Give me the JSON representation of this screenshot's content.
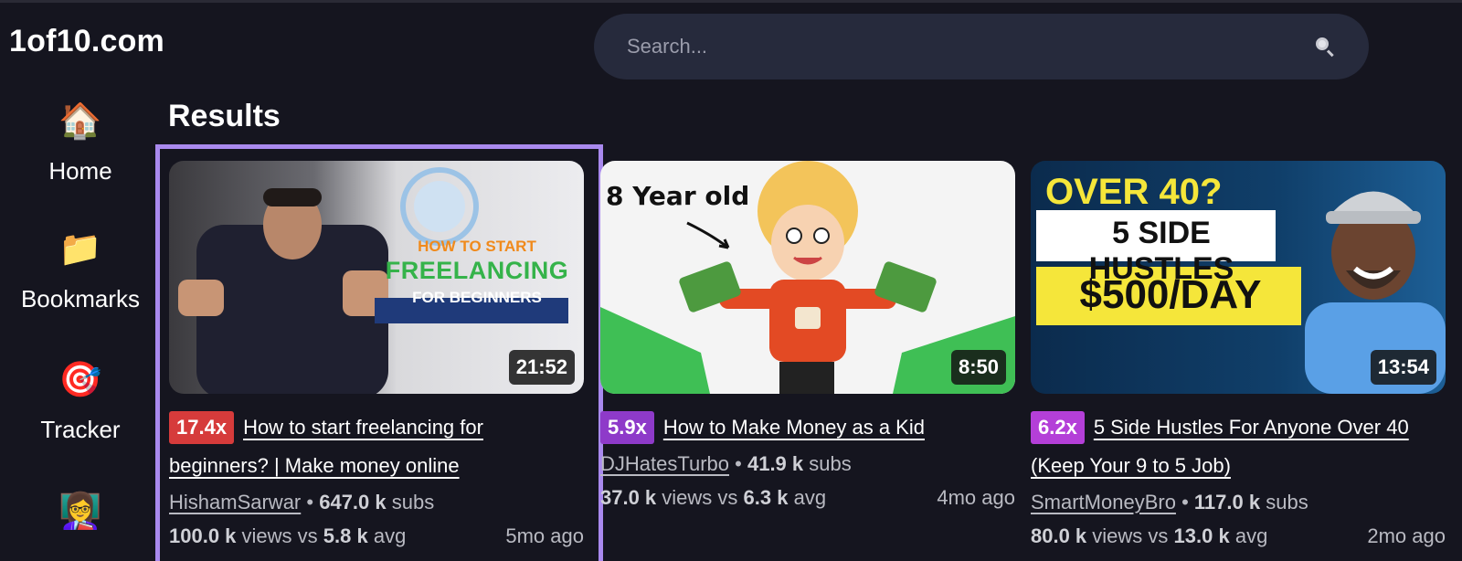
{
  "app": {
    "logo": "1of10.com"
  },
  "search": {
    "placeholder": "Search..."
  },
  "sidebar": {
    "items": [
      {
        "label": "Home",
        "icon": "house-icon",
        "glyph": "🏠"
      },
      {
        "label": "Bookmarks",
        "icon": "folder-icon",
        "glyph": "📁"
      },
      {
        "label": "Tracker",
        "icon": "target-icon",
        "glyph": "🎯"
      },
      {
        "label": "",
        "icon": "person-icon",
        "glyph": "👩‍🏫"
      }
    ]
  },
  "main": {
    "title": "Results",
    "cards": [
      {
        "duration": "21:52",
        "multiplier": "17.4x",
        "multiplier_color": "#d63b3b",
        "title": "How to start freelancing for beginners? | Make money online",
        "channel": "HishamSarwar",
        "subs_value": "647.0 k",
        "subs_label": "subs",
        "views_value": "100.0 k",
        "views_label": "views vs",
        "avg_value": "5.8 k",
        "avg_label": "avg",
        "age": "5mo ago",
        "thumb_text": [
          "HOW TO START",
          "FREELANCING",
          "FOR BEGINNERS"
        ]
      },
      {
        "duration": "8:50",
        "multiplier": "5.9x",
        "multiplier_color": "#8e3ac9",
        "title": "How to Make Money as a Kid",
        "channel": "DJHatesTurbo",
        "subs_value": "41.9 k",
        "subs_label": "subs",
        "views_value": "37.0 k",
        "views_label": "views vs",
        "avg_value": "6.3 k",
        "avg_label": "avg",
        "age": "4mo ago",
        "thumb_text": [
          "8 Year old"
        ]
      },
      {
        "duration": "13:54",
        "multiplier": "6.2x",
        "multiplier_color": "#b43fd8",
        "title": "5 Side Hustles For Anyone Over 40 (Keep Your 9 to 5 Job)",
        "channel": "SmartMoneyBro",
        "subs_value": "117.0 k",
        "subs_label": "subs",
        "views_value": "80.0 k",
        "views_label": "views vs",
        "avg_value": "13.0 k",
        "avg_label": "avg",
        "age": "2mo ago",
        "thumb_text": [
          "OVER 40?",
          "5 SIDE HUSTLES",
          "$500/DAY"
        ]
      }
    ]
  }
}
